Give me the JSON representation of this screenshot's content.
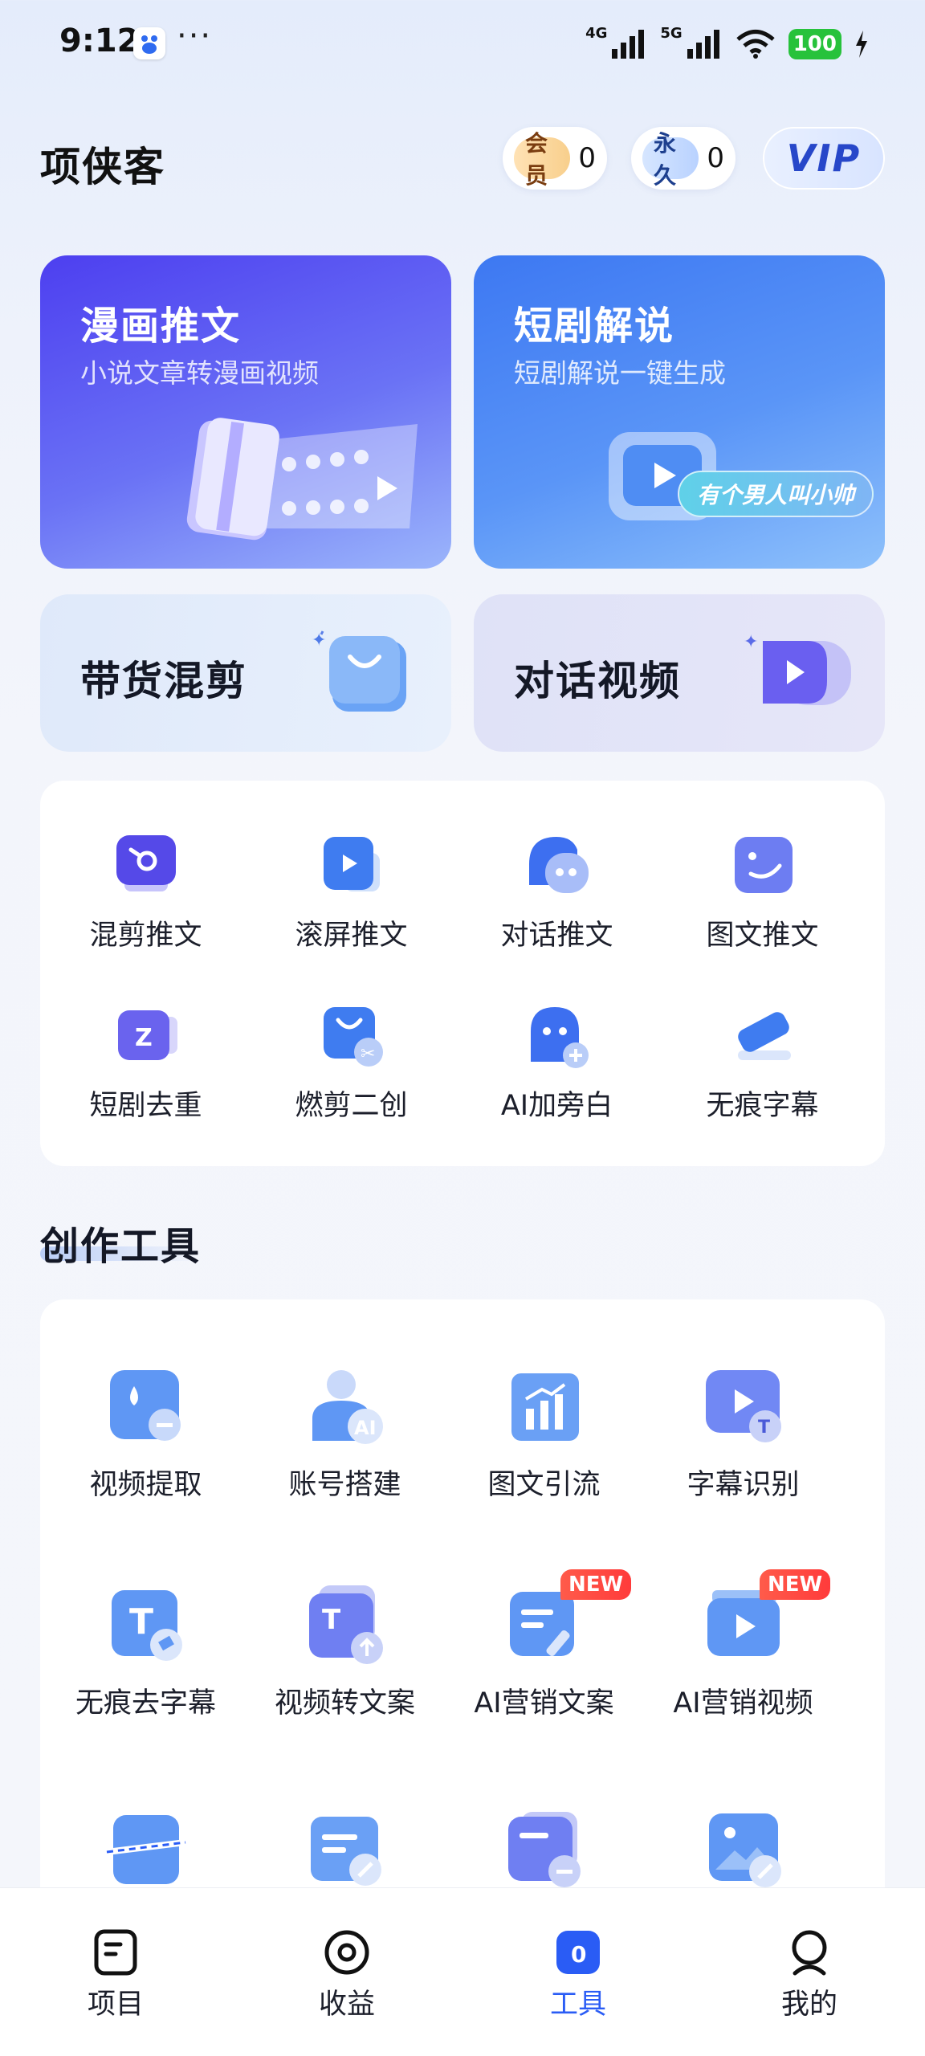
{
  "status_bar": {
    "time": "9:12",
    "dots": "···",
    "net1": "4G",
    "net2": "5G",
    "battery": "100"
  },
  "header": {
    "title": "项侠客",
    "member_label": "会员",
    "member_count": "0",
    "forever_label": "永久",
    "forever_count": "0",
    "vip_label": "VIP"
  },
  "feature_cards": [
    {
      "title": "漫画推文",
      "subtitle": "小说文章转漫画视频"
    },
    {
      "title": "短剧解说",
      "subtitle": "短剧解说一键生成",
      "tag": "有个男人叫小帅"
    }
  ],
  "mid_cards": [
    {
      "title": "带货混剪"
    },
    {
      "title": "对话视频"
    }
  ],
  "quick_tools": [
    {
      "label": "混剪推文"
    },
    {
      "label": "滚屏推文"
    },
    {
      "label": "对话推文"
    },
    {
      "label": "图文推文"
    },
    {
      "label": "短剧去重"
    },
    {
      "label": "燃剪二创"
    },
    {
      "label": "AI加旁白"
    },
    {
      "label": "无痕字幕"
    }
  ],
  "creation_section": {
    "title": "创作工具",
    "items": [
      {
        "label": "视频提取"
      },
      {
        "label": "账号搭建"
      },
      {
        "label": "图文引流"
      },
      {
        "label": "字幕识别"
      },
      {
        "label": "无痕去字幕"
      },
      {
        "label": "视频转文案"
      },
      {
        "label": "AI营销文案",
        "badge": "NEW"
      },
      {
        "label": "AI营销视频",
        "badge": "NEW"
      }
    ]
  },
  "bottom_nav": [
    {
      "label": "项目"
    },
    {
      "label": "收益"
    },
    {
      "label": "工具",
      "badge": "0"
    },
    {
      "label": "我的"
    }
  ],
  "colors": {
    "accent": "#2a5cf5",
    "battery": "#27c23b",
    "new_badge": "#ff4a42"
  }
}
